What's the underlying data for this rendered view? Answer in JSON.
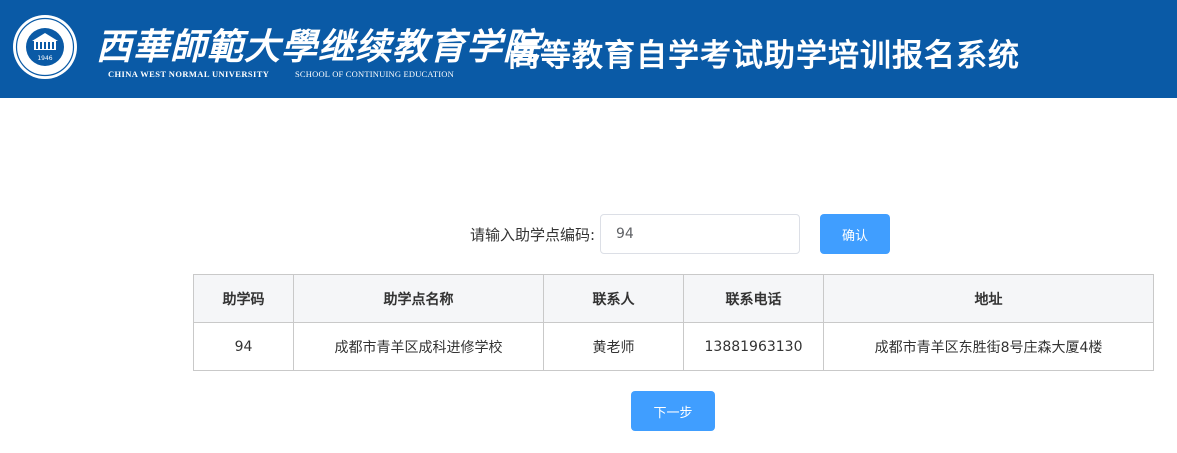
{
  "header": {
    "logo_cn": "西華師範大學继续教育学院",
    "logo_en_left": "CHINA WEST NORMAL UNIVERSITY",
    "logo_en_right": "SCHOOL OF CONTINUING EDUCATION",
    "seal_year": "1946",
    "system_title": "高等教育自学考试助学培训报名系统",
    "bg_color": "#0a5aa6"
  },
  "search": {
    "label": "请输入助学点编码:",
    "value": "94",
    "confirm_label": "确认"
  },
  "table": {
    "headers": [
      "助学码",
      "助学点名称",
      "联系人",
      "联系电话",
      "地址"
    ],
    "rows": [
      [
        "94",
        "成都市青羊区成科进修学校",
        "黄老师",
        "13881963130",
        "成都市青羊区东胜街8号庄森大厦4楼"
      ]
    ]
  },
  "next_label": "下一步",
  "accent_color": "#409eff"
}
